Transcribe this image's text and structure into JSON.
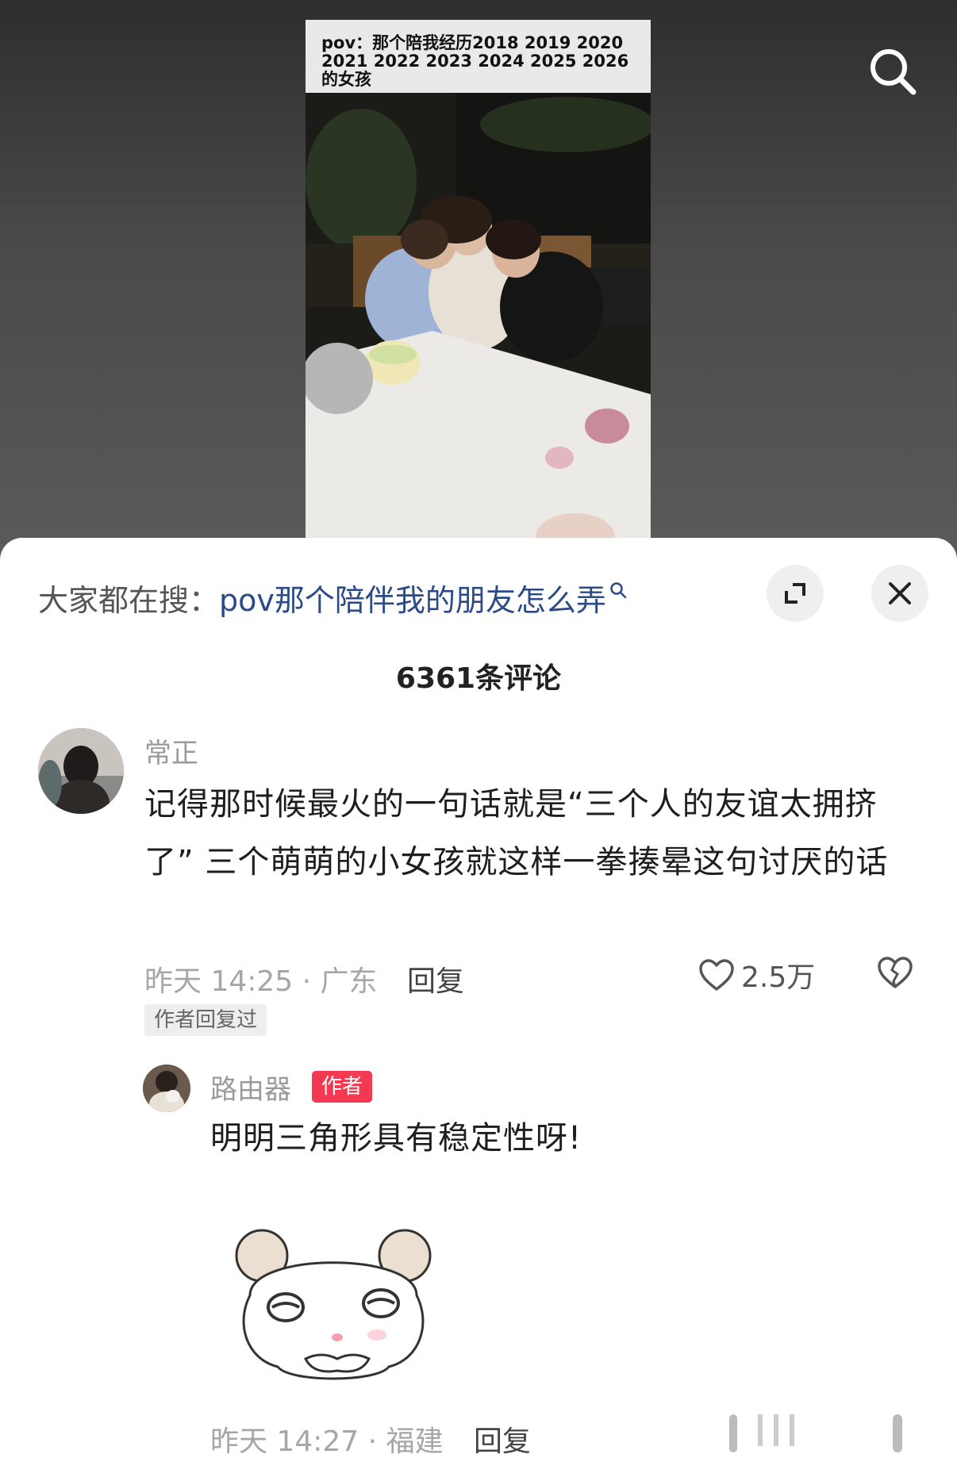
{
  "video": {
    "caption_line1": "pov：那个陪我经历2018 2019 2020",
    "caption_line2": "2021 2022 2023 2024 2025 2026的女孩"
  },
  "panel": {
    "hot_search_prefix": "大家都在搜：",
    "hot_search_query": "pov那个陪伴我的朋友怎么弄",
    "comment_count": "6361条评论"
  },
  "comments": [
    {
      "username": "常正",
      "text": "记得那时候最火的一句话就是“三个人的友谊太拥挤了” 三个萌萌的小女孩就这样一拳揍晕这句讨厌的话",
      "meta": "昨天 14:25 · 广东",
      "reply_label": "回复",
      "likes": "2.5万",
      "author_replied_tag": "作者回复过"
    }
  ],
  "reply": {
    "username": "路由器",
    "badge": "作者",
    "text": "明明三角形具有稳定性呀!",
    "meta": "昨天 14:27 · 福建",
    "reply_label": "回复"
  },
  "icons": {
    "search": "search-icon",
    "expand": "expand-icon",
    "close": "close-icon",
    "heart": "heart-icon",
    "dislike": "broken-heart-icon"
  },
  "colors": {
    "link": "#2b4a86",
    "author_badge": "#f33a52"
  }
}
